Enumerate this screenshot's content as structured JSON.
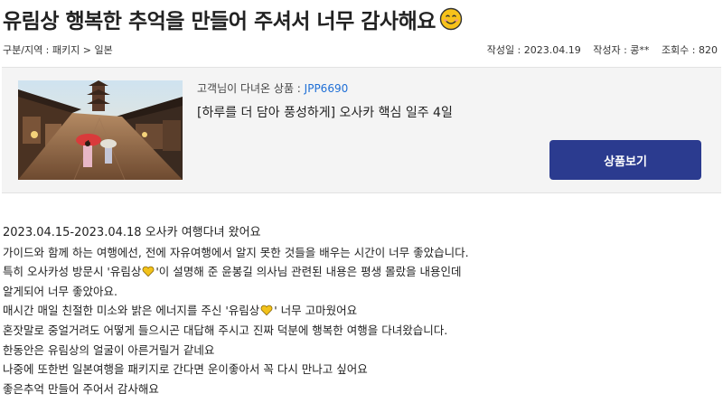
{
  "post": {
    "title": "유림상 행복한 추억을 만들어 주셔서 너무 감사해요",
    "title_emoji": "smiling-face-icon"
  },
  "meta": {
    "category": "구분/지역 : 패키지 > 일본",
    "date": "작성일 : 2023.04.19",
    "author": "작성자 : 콩**",
    "views": "조회수 : 820"
  },
  "product": {
    "label": "고객님이 다녀온 상품 : ",
    "code": "JPP6690",
    "name": "[하루를 더 담아 풍성하게] 오사카 핵심 일주 4일",
    "button": "상품보기"
  },
  "body": {
    "lines": [
      "2023.04.15-2023.04.18 오사카 여행다녀 왔어요",
      "가이드와 함께 하는 여행에선, 전에 자유여행에서 알지 못한 것들을 배우는 시간이 너무 좋았습니다.",
      "특히 오사카성 방문시 '유림상",
      "'이 설명해 준 윤봉길 의사님 관련된 내용은 평생 몰랐을 내용인데",
      "알게되어 너무 좋았아요.",
      "매시간 매일 친절한 미소와 밝은 에너지를 주신 '유림상",
      "' 너무 고마웠어요",
      "혼잣말로 중얼거려도 어떻게 들으시곤 대답해 주시고 진짜 덕분에 행복한 여행을 다녀왔습니다.",
      "한동안은 유림상의 얼굴이 아른거릴거 같네요",
      "나중에 또한번 일본여행을 패키지로 간다면 운이좋아서 꼭 다시 만나고 싶어요",
      "좋은추억 만들어 주어서 감사해요"
    ]
  },
  "colors": {
    "button_bg": "#2b3b8f",
    "code_link": "#1f6fd6",
    "card_bg": "#f4f4f4"
  }
}
